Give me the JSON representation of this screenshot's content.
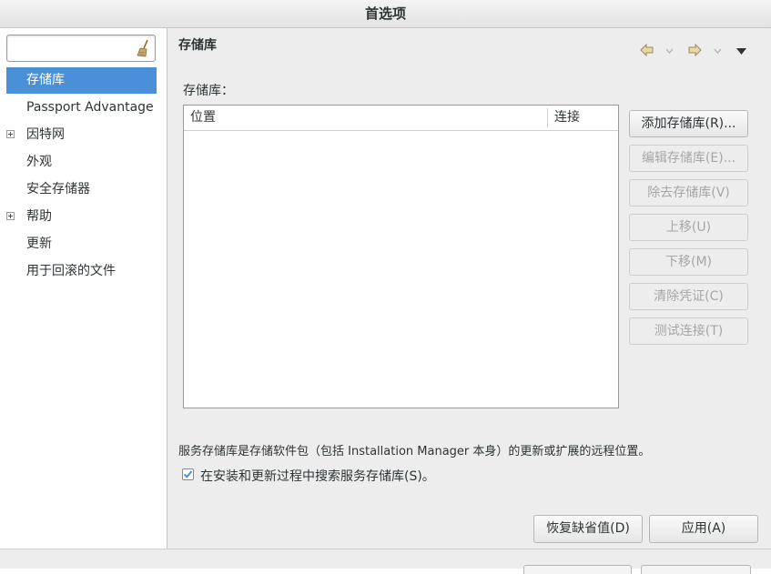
{
  "window": {
    "title": "首选项"
  },
  "sidebar": {
    "filter": {
      "value": "",
      "placeholder": ""
    },
    "items": [
      {
        "label": "存储库",
        "selected": true,
        "expandable": false
      },
      {
        "label": "Passport Advantage",
        "selected": false,
        "expandable": false
      },
      {
        "label": "因特网",
        "selected": false,
        "expandable": true
      },
      {
        "label": "外观",
        "selected": false,
        "expandable": false
      },
      {
        "label": "安全存储器",
        "selected": false,
        "expandable": false
      },
      {
        "label": "帮助",
        "selected": false,
        "expandable": true
      },
      {
        "label": "更新",
        "selected": false,
        "expandable": false
      },
      {
        "label": "用于回滚的文件",
        "selected": false,
        "expandable": false
      }
    ]
  },
  "page": {
    "title": "存储库",
    "repos_label": "存储库：",
    "table": {
      "columns": [
        "位置",
        "连接"
      ],
      "rows": []
    },
    "buttons": {
      "add": "添加存储库(R)...",
      "edit": "编辑存储库(E)...",
      "remove": "除去存储库(V)",
      "up": "上移(U)",
      "down": "下移(M)",
      "clear": "清除凭证(C)",
      "test": "测试连接(T)"
    },
    "description": "服务存储库是存储软件包（包括 Installation Manager 本身）的更新或扩展的远程位置。",
    "search_checkbox": {
      "label": "在安装和更新过程中搜索服务存储库(S)。",
      "checked": true
    },
    "restore_defaults": "恢复缺省值(D)",
    "apply": "应用(A)"
  },
  "colors": {
    "selection": "#4a90d9",
    "check": "#4a90d9"
  }
}
